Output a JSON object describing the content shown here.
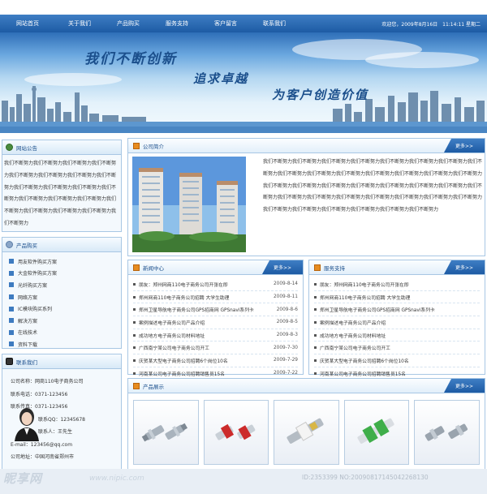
{
  "nav": {
    "items": [
      "网站首页",
      "关于我们",
      "产品购买",
      "服务支持",
      "客户留言",
      "联系我们"
    ],
    "welcome": "欢迎您，2009年8月16日　11:14:11 星期二"
  },
  "banner": {
    "slogan1": "我们不断创新",
    "slogan2": "追求卓越",
    "slogan3": "为客户创造价值"
  },
  "notice": {
    "title": "网站公告",
    "text": "我们不断努力我们不断努力我们不断努力我们不断努力我们不断努力我们不断努力我们不断努力我们不断努力我们不断努力我们不断努力我们不断努力我们不断努力我们不断努力我们不断努力我们不断努力我们不断努力我们不断努力我们不断努力我们不断努力我们不断努力"
  },
  "products": {
    "title": "产品购买",
    "items": [
      "用友软件购买方案",
      "大金软件购买方案",
      "光纤购买方案",
      "网络方案",
      "IC模块购买系列",
      "解决方案",
      "在线技术",
      "资料下载"
    ]
  },
  "contact": {
    "title": "联系我们",
    "lines": [
      "公司名称：网商110电子商务公司",
      "联系电话：0371-123456",
      "联系传真：0371-123456",
      "联系QQ：12345678",
      "联系人：王先生",
      "E-mail：123456@qq.com",
      "公司地址：中国河南省郑州市"
    ]
  },
  "company": {
    "title": "公司简介",
    "more": "更多>>",
    "text": "我们不断努力我们不断努力我们不断努力我们不断努力我们不断努力我们不断努力我们不断努力我们不断努力我们不断努力我们不断努力我们不断努力我们不断努力我们不断努力我们不断努力我们不断努力我们不断努力我们不断努力我们不断努力我们不断努力我们不断努力我们不断努力我们不断努力我们不断努力我们不断努力我们不断努力我们不断努力我们不断努力我们不断努力我们不断努力我们不断努力我们不断努力我们不断努力我们不断努力我们不断努力我们不断努力我们不断努力"
  },
  "news": {
    "title": "新闻中心",
    "more": "更多>>",
    "items": [
      {
        "title": "朋友：郑州网商110电子商务公司开张在即",
        "date": "2009-8-14"
      },
      {
        "title": "郑州网商110电子商务公司招聘 大学生助理",
        "date": "2009-8-11"
      },
      {
        "title": "郑州卫星导航电子商务公司GPS招商网 GPSnavi系列卡",
        "date": "2009-8-6"
      },
      {
        "title": "案例描述电子商务公司产品介绍",
        "date": "2009-8-5"
      },
      {
        "title": "成功地方电子商务公司材料地址",
        "date": "2009-8-3"
      },
      {
        "title": "广西南宁某公司电子商务公司开工",
        "date": "2009-7-30"
      },
      {
        "title": "庆贺某大型电子商务公司招聘6个岗位10名",
        "date": "2009-7-29"
      },
      {
        "title": "河南某公司电子商务公司招聘销售员15名",
        "date": "2009-7-22"
      }
    ]
  },
  "service": {
    "title": "服务支持",
    "more": "更多>>",
    "items": [
      "朋友：郑州网商110电子商务公司开张在即",
      "郑州网商110电子商务公司招聘 大学生助理",
      "郑州卫星导航电子商务公司GPS招商网 GPSnavi系列卡",
      "案例描述电子商务公司产品介绍",
      "成功地方电子商务公司材料地址",
      "广西南宁某公司电子商务公司开工",
      "庆贺某大型电子商务公司招聘6个岗位10名",
      "河南某公司电子商务公司招聘销售员15名"
    ]
  },
  "showcase": {
    "title": "产品展示",
    "more": "更多>>",
    "items": [
      "silver-fiber-adapter",
      "red-fiber-adapter",
      "white-fiber-adapter",
      "green-fiber-adapter",
      "grey-fiber-adapter"
    ]
  },
  "watermark": {
    "logo": "昵享网",
    "url": "www.nipic.com",
    "id": "ID:2353399 NO:20090817145042268130"
  },
  "colors": {
    "nav": "#2360a8",
    "accent": "#1b4f8c",
    "border": "#a8c7e4",
    "more": "#2a6bb6"
  }
}
